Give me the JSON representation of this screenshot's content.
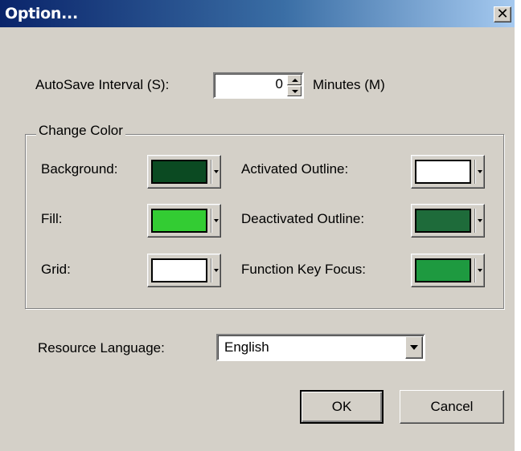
{
  "window": {
    "title": "Option...",
    "close_glyph": "✕"
  },
  "autosave": {
    "label": "AutoSave Interval (S):",
    "value": "0",
    "unit": "Minutes (M)"
  },
  "change_color": {
    "title": "Change Color",
    "items": [
      {
        "label": "Background:",
        "color": "#0b4a22"
      },
      {
        "label": "Fill:",
        "color": "#33cc33"
      },
      {
        "label": "Grid:",
        "color": "#ffffff"
      },
      {
        "label": "Activated Outline:",
        "color": "#ffffff"
      },
      {
        "label": "Deactivated Outline:",
        "color": "#1e6b3a"
      },
      {
        "label": "Function Key Focus:",
        "color": "#1e9a40"
      }
    ]
  },
  "resource_language": {
    "label": "Resource Language:",
    "selected": "English"
  },
  "buttons": {
    "ok": "OK",
    "cancel": "Cancel"
  },
  "colors": {
    "dialog_bg": "#d4d0c8",
    "title_bar_start": "#0a246a",
    "title_bar_end": "#a6caf0"
  }
}
